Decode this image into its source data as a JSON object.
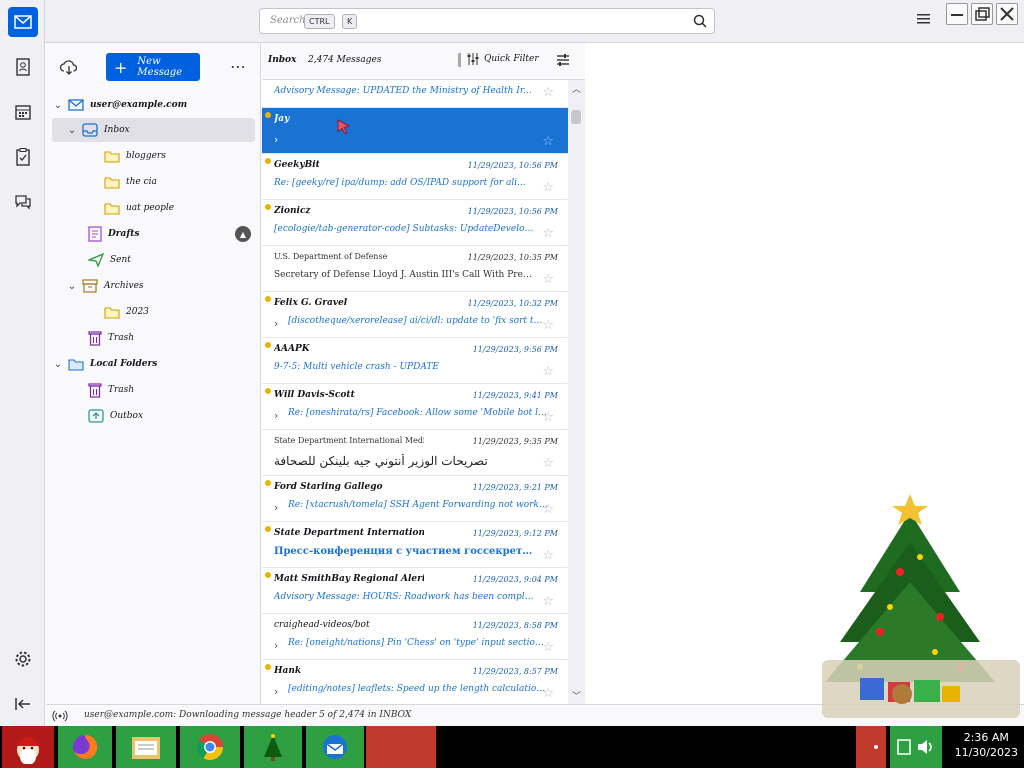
{
  "search": {
    "placeholder": "Search…",
    "key1": "CTRL",
    "key2": "K"
  },
  "folder_pane": {
    "new_message": "New Message",
    "account": "user@example.com",
    "folders": [
      {
        "label": "Inbox"
      },
      {
        "label": "bloggers"
      },
      {
        "label": "the cia"
      },
      {
        "label": "uat people"
      },
      {
        "label": "Drafts"
      },
      {
        "label": "Sent"
      },
      {
        "label": "Archives"
      },
      {
        "label": "2023"
      },
      {
        "label": "Trash"
      },
      {
        "label": "Local Folders"
      },
      {
        "label": "Trash"
      },
      {
        "label": "Outbox"
      }
    ],
    "drafts_badge": ""
  },
  "thread_header": {
    "folder": "Inbox",
    "count": "2,474 Messages",
    "quick_filter": "Quick Filter"
  },
  "messages": [
    {
      "from": "",
      "date": "",
      "subject": "Advisory Message: UPDATED the Ministry of Health Ir...",
      "starred": false,
      "unread": false,
      "thread": false
    },
    {
      "from": "Jay",
      "date": "",
      "subject": "",
      "starred": true,
      "unread": true,
      "thread": true,
      "selected": true
    },
    {
      "from": "GeekyBit",
      "date": "11/29/2023, 10:56 PM",
      "subject": "Re: [geeky/re] ipa/dump: add OS/IPAD support for ali...",
      "unread": true
    },
    {
      "from": "Zionicz",
      "date": "11/29/2023, 10:56 PM",
      "subject": "[ecologie/tab-generator-code] Subtasks: UpdateDevelop...",
      "unread": true
    },
    {
      "from": "U.S. Department of Defense",
      "date": "11/29/2023, 10:35 PM",
      "subject": "Secretary of Defense Lloyd J. Austin III's Call With Presid...",
      "plain": true
    },
    {
      "from": "Felix G. Gravel",
      "date": "11/29/2023, 10:32 PM",
      "subject": "[discotheque/xerorelease] ai/ci/dl: update to 'fix sort the c...",
      "unread": true,
      "thread": true
    },
    {
      "from": "AAAPK",
      "date": "11/29/2023, 9:56 PM",
      "subject": "9-7-5: Multi vehicle crash - UPDATE",
      "unread": true
    },
    {
      "from": "Will Davis-Scott",
      "date": "11/29/2023, 9:41 PM",
      "subject": "Re: [oneshirata/rs] Facebook: Allow some 'Mobile bot link...",
      "unread": true,
      "thread": true
    },
    {
      "from": "State Department International Media Engag...",
      "date": "11/29/2023, 9:35 PM",
      "subject": "تصريحات الوزير أنتوني جيه بلينكن للصحافة",
      "plain": true,
      "lang": "ar"
    },
    {
      "from": "Ford Starling Gallego",
      "date": "11/29/2023, 9:21 PM",
      "subject": "Re: [xtacrush/tomela] SSH Agent Forwarding not working alt...",
      "unread": true,
      "thread": true
    },
    {
      "from": "State Department International Media E...",
      "date": "11/29/2023, 9:12 PM",
      "subject": "Пресс-конференция с участием госсекретар...",
      "unread": true,
      "lang": "ru"
    },
    {
      "from": "Matt SmithBay Regional Alert and W...",
      "date": "11/29/2023, 9:04 PM",
      "subject": "Advisory Message: HOURS: Roadwork has been completed...",
      "unread": true
    },
    {
      "from": "craighead-videos/bot",
      "date": "11/29/2023, 8:58 PM",
      "subject": "Re: [oneight/nations] Pin 'Chess' on 'type' input sections occur...",
      "thread": true
    },
    {
      "from": "Hank",
      "date": "11/29/2023, 8:57 PM",
      "subject": "[editing/notes] leaflets: Speed up the length calculation used by...",
      "unread": true,
      "thread": true
    }
  ],
  "status_bar": {
    "text": "user@example.com: Downloading message header 5 of 2,474 in INBOX"
  },
  "taskbar": {
    "time": "2:36 AM",
    "date": "11/30/2023"
  },
  "colors": {
    "accent": "#0061e0",
    "selected_row": "#1a72d4",
    "unread_dot": "#e8b400"
  }
}
